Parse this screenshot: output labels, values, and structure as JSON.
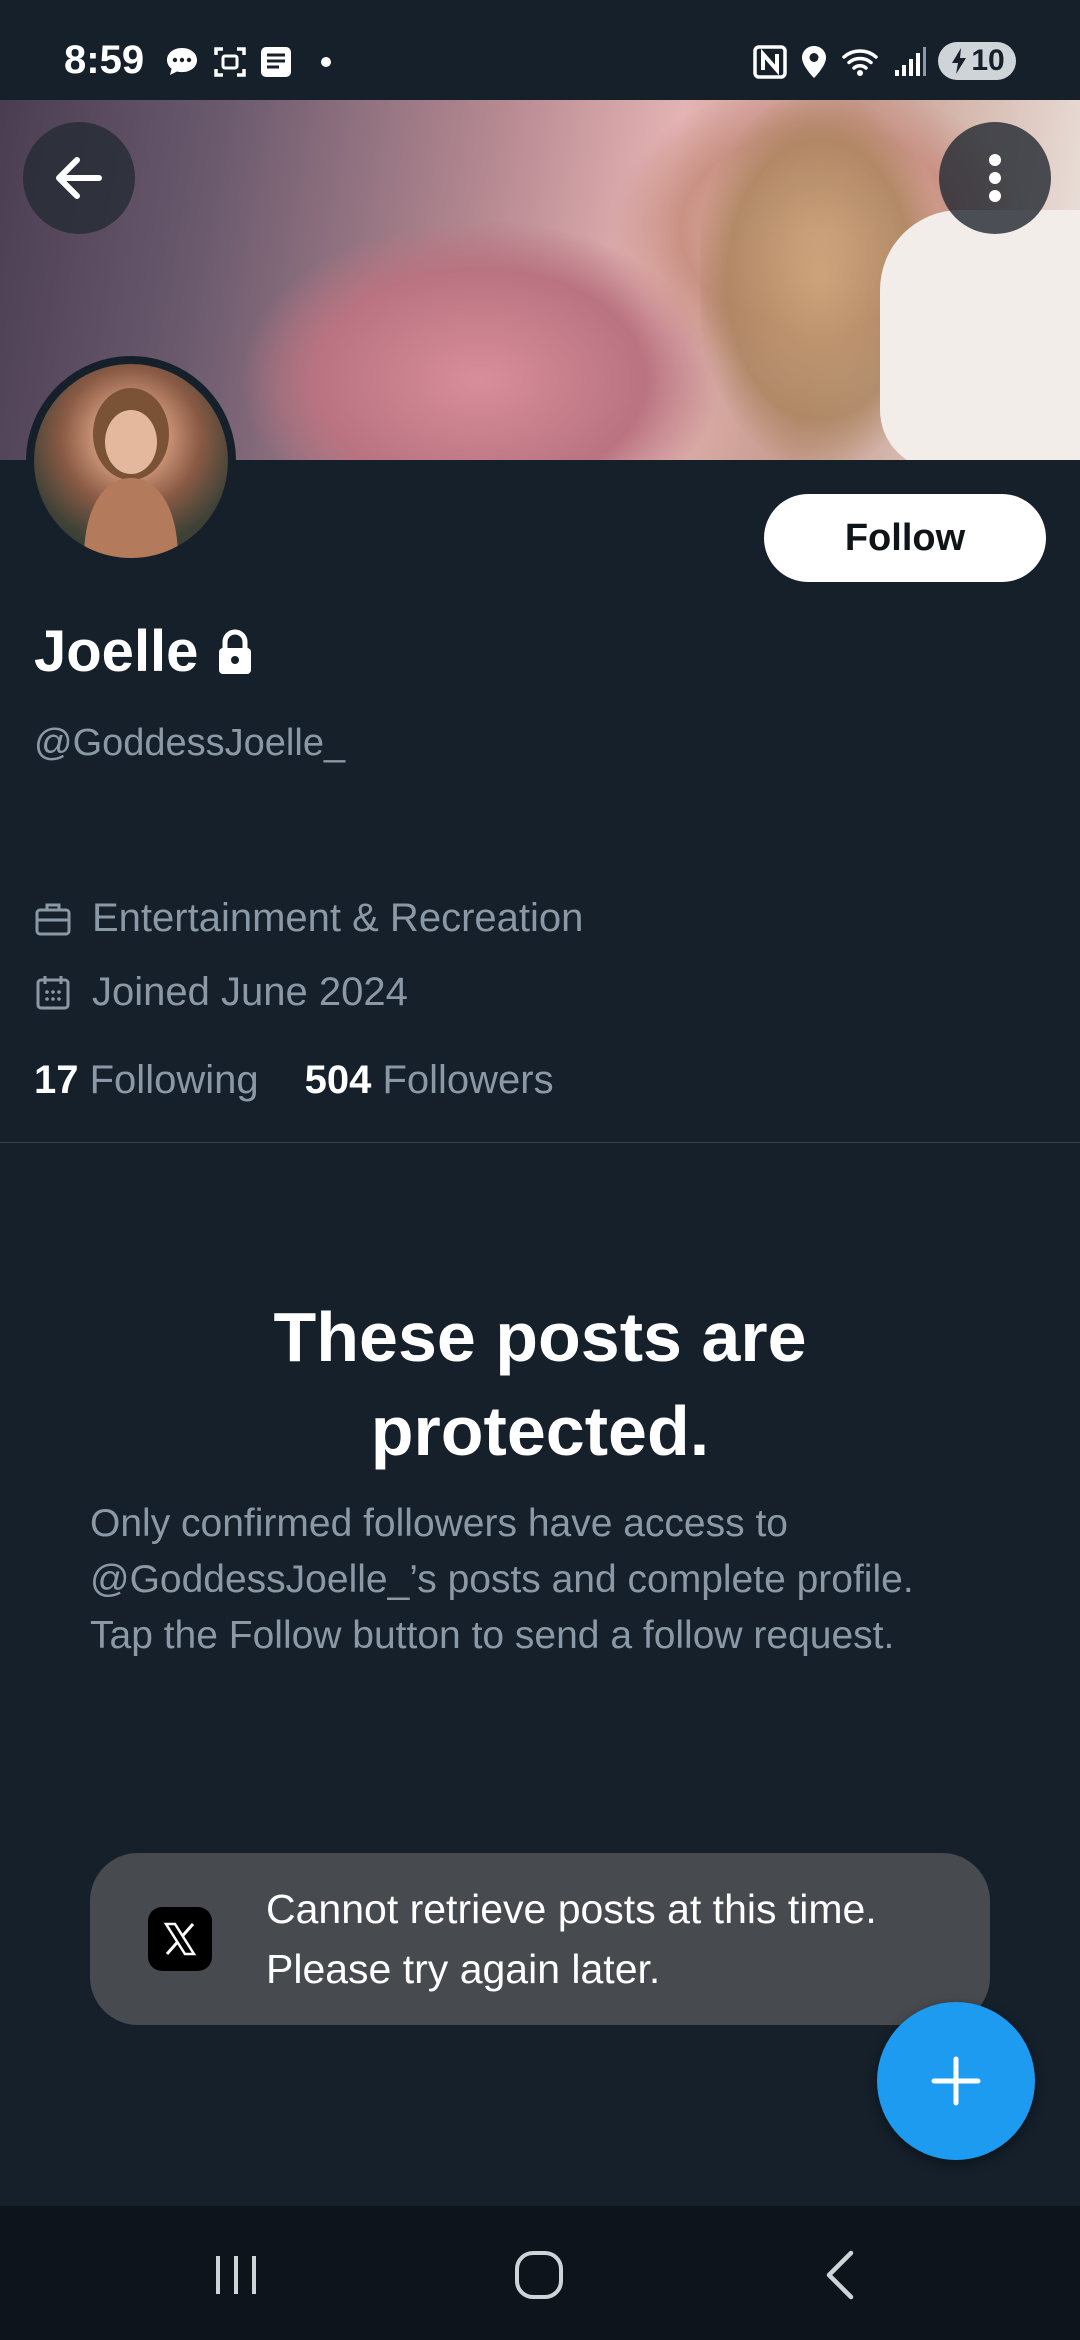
{
  "status_bar": {
    "time": "8:59",
    "battery": "10",
    "icons": [
      "chat-bubble-icon",
      "screenshot-icon",
      "message-icon",
      "dot-icon",
      "nfc-icon",
      "location-icon",
      "wifi-icon",
      "signal-icon",
      "battery-charging-icon"
    ]
  },
  "profile": {
    "display_name": "Joelle",
    "handle": "@GoddessJoelle_",
    "category": "Entertainment & Recreation",
    "joined": "Joined June 2024",
    "following_count": "17",
    "following_label": "Following",
    "followers_count": "504",
    "followers_label": "Followers",
    "protected": true
  },
  "actions": {
    "follow_label": "Follow"
  },
  "protected_notice": {
    "title_line1": "These posts are",
    "title_line2": "protected.",
    "line1": "Only confirmed followers have access to",
    "line2": "@GoddessJoelle_’s posts and complete profile.",
    "line3": "Tap the Follow button to send a follow request."
  },
  "toast": {
    "line1": "Cannot retrieve posts at this time.",
    "line2": "Please try again later."
  },
  "colors": {
    "background": "#15202b",
    "accent": "#1d9bf0",
    "secondary_text": "#8b98a5"
  }
}
